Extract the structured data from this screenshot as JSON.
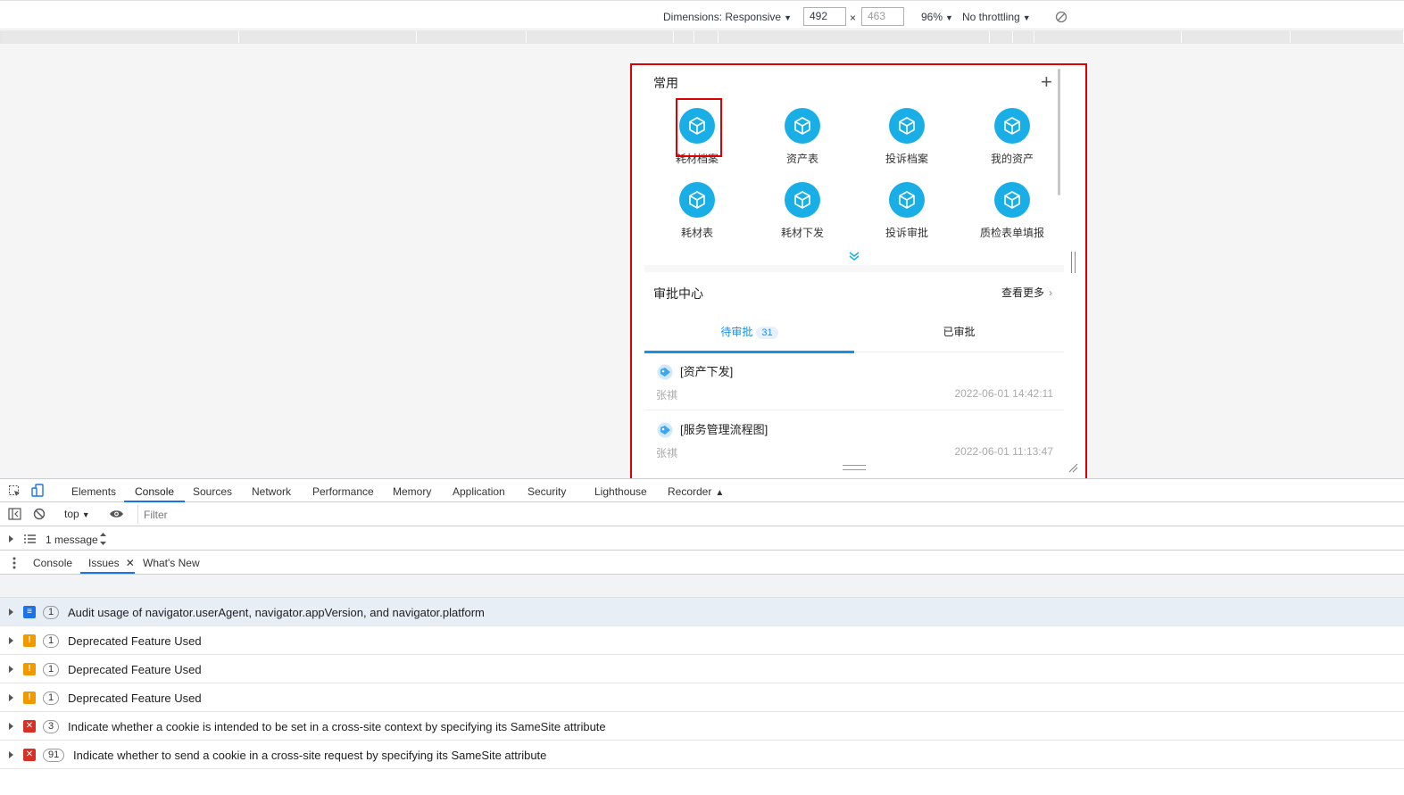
{
  "device_toolbar": {
    "dimensions_label": "Dimensions: Responsive",
    "width": "492",
    "times": "×",
    "height": "463",
    "zoom": "96%",
    "throttling": "No throttling"
  },
  "common": {
    "title": "常用",
    "apps": [
      {
        "label": "耗材档案"
      },
      {
        "label": "资产表"
      },
      {
        "label": "投诉档案"
      },
      {
        "label": "我的资产"
      },
      {
        "label": "耗材表"
      },
      {
        "label": "耗材下发"
      },
      {
        "label": "投诉审批"
      },
      {
        "label": "质检表单填报"
      }
    ]
  },
  "approval": {
    "title": "审批中心",
    "view_more": "查看更多",
    "tabs": [
      {
        "label": "待审批",
        "count": "31"
      },
      {
        "label": "已审批"
      }
    ],
    "items": [
      {
        "title": "[资产下发]",
        "user": "张祺",
        "time": "2022-06-01 14:42:11"
      },
      {
        "title": "[服务管理流程图]",
        "user": "张祺",
        "time": "2022-06-01 11:13:47"
      }
    ]
  },
  "devtools": {
    "tabs": [
      "Elements",
      "Console",
      "Sources",
      "Network",
      "Performance",
      "Memory",
      "Application",
      "Security",
      "Lighthouse",
      "Recorder"
    ],
    "context": "top",
    "filter_placeholder": "Filter",
    "message_count": "1 message",
    "drawer_tabs": [
      "Console",
      "Issues",
      "What's New"
    ],
    "issues": [
      {
        "type": "info",
        "count": "1",
        "text": "Audit usage of navigator.userAgent, navigator.appVersion, and navigator.platform",
        "color": "#1a73e8"
      },
      {
        "type": "warning",
        "count": "1",
        "text": "Deprecated Feature Used",
        "color": "#f29900"
      },
      {
        "type": "warning",
        "count": "1",
        "text": "Deprecated Feature Used",
        "color": "#f29900"
      },
      {
        "type": "warning",
        "count": "1",
        "text": "Deprecated Feature Used",
        "color": "#f29900"
      },
      {
        "type": "error",
        "count": "3",
        "text": "Indicate whether a cookie is intended to be set in a cross-site context by specifying its SameSite attribute",
        "color": "#d93025"
      },
      {
        "type": "error",
        "count": "91",
        "text": "Indicate whether to send a cookie in a cross-site request by specifying its SameSite attribute",
        "color": "#d93025"
      }
    ]
  },
  "colors": {
    "accent": "#1aaee7",
    "tab_active": "#1a8fe3",
    "highlight": "#e00000"
  }
}
